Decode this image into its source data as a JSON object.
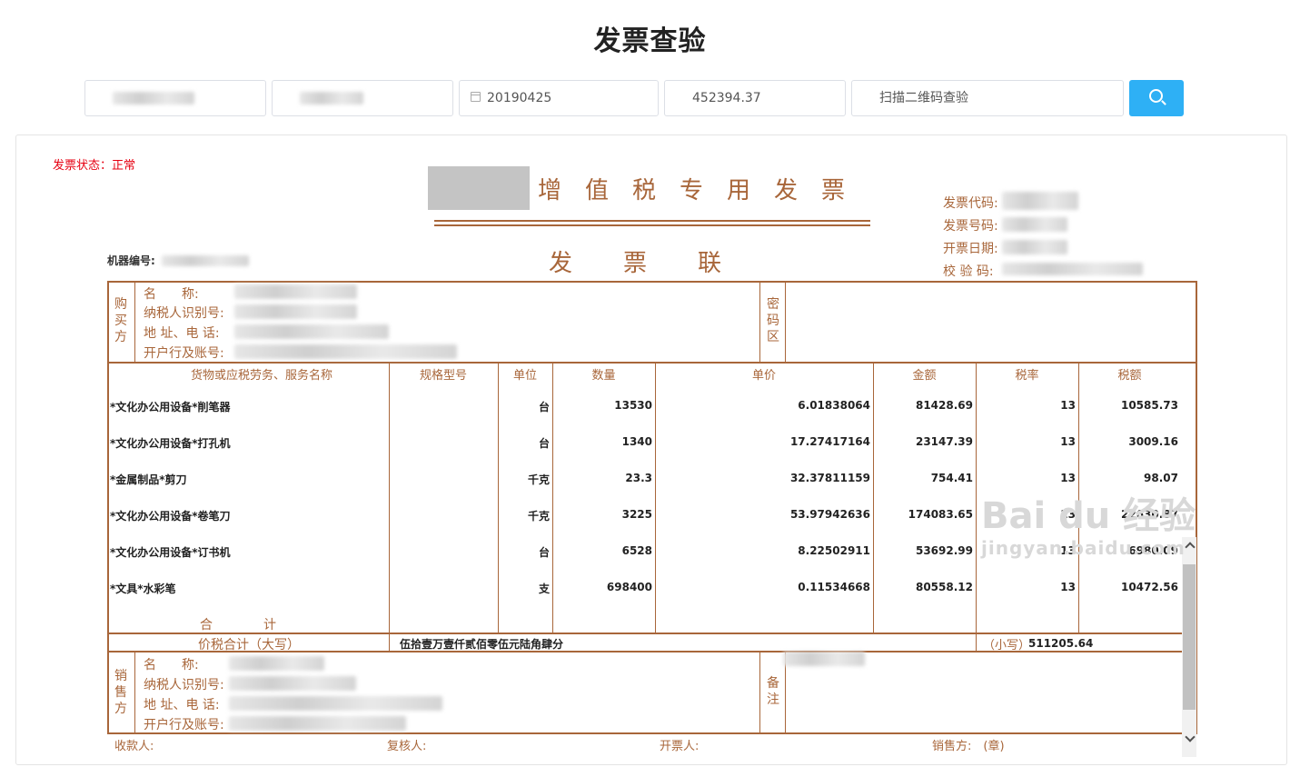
{
  "page_title": "发票查验",
  "search": {
    "date_value": "20190425",
    "amount_value": "452394.37",
    "qr_placeholder": "扫描二维码查验"
  },
  "status": {
    "label": "发票状态：",
    "value": "正常"
  },
  "invoice": {
    "title": "增值税专用发票",
    "subtitle": "发票联",
    "machine_no_label": "机器编号:",
    "meta_labels": [
      "发票代码:",
      "发票号码:",
      "开票日期:",
      "校 验 码:"
    ],
    "buyer_side": "购买方",
    "seller_side": "销售方",
    "password_area": "密码区",
    "remark": "备注",
    "party_fields": [
      "名　　称:",
      "纳税人识别号:",
      "地 址、电 话:",
      "开户行及账号:"
    ],
    "columns": [
      "货物或应税劳务、服务名称",
      "规格型号",
      "单位",
      "数量",
      "单价",
      "金额",
      "税率",
      "税额"
    ],
    "items": [
      {
        "name": "*文化办公用设备*削笔器",
        "spec": "",
        "unit": "台",
        "qty": "13530",
        "price": "6.01838064",
        "amount": "81428.69",
        "rate": "13",
        "tax": "10585.73"
      },
      {
        "name": "*文化办公用设备*打孔机",
        "spec": "",
        "unit": "台",
        "qty": "1340",
        "price": "17.27417164",
        "amount": "23147.39",
        "rate": "13",
        "tax": "3009.16"
      },
      {
        "name": "*金属制品*剪刀",
        "spec": "",
        "unit": "千克",
        "qty": "23.3",
        "price": "32.37811159",
        "amount": "754.41",
        "rate": "13",
        "tax": "98.07"
      },
      {
        "name": "*文化办公用设备*卷笔刀",
        "spec": "",
        "unit": "千克",
        "qty": "3225",
        "price": "53.97942636",
        "amount": "174083.65",
        "rate": "13",
        "tax": "22630.87"
      },
      {
        "name": "*文化办公用设备*订书机",
        "spec": "",
        "unit": "台",
        "qty": "6528",
        "price": "8.22502911",
        "amount": "53692.99",
        "rate": "13",
        "tax": "6980.09"
      },
      {
        "name": "*文具*水彩笔",
        "spec": "",
        "unit": "支",
        "qty": "698400",
        "price": "0.11534668",
        "amount": "80558.12",
        "rate": "13",
        "tax": "10472.56"
      }
    ],
    "total_label": "合　　　　计",
    "total_in_words_label": "价税合计（大写）",
    "total_in_words": "伍拾壹万壹仟贰佰零伍元陆角肆分",
    "total_small_label": "（小写）",
    "total_small": "511205.64",
    "footer": {
      "payee": "收款人:",
      "reviewer": "复核人:",
      "drawer": "开票人:",
      "seller": "销售方:　(章)"
    }
  },
  "watermark": {
    "brand": "Bai du 经验",
    "url": "jingyan.baidu.com"
  },
  "colors": {
    "accent": "#a8663a",
    "button": "#2eb0f5",
    "status": "#e60012"
  }
}
